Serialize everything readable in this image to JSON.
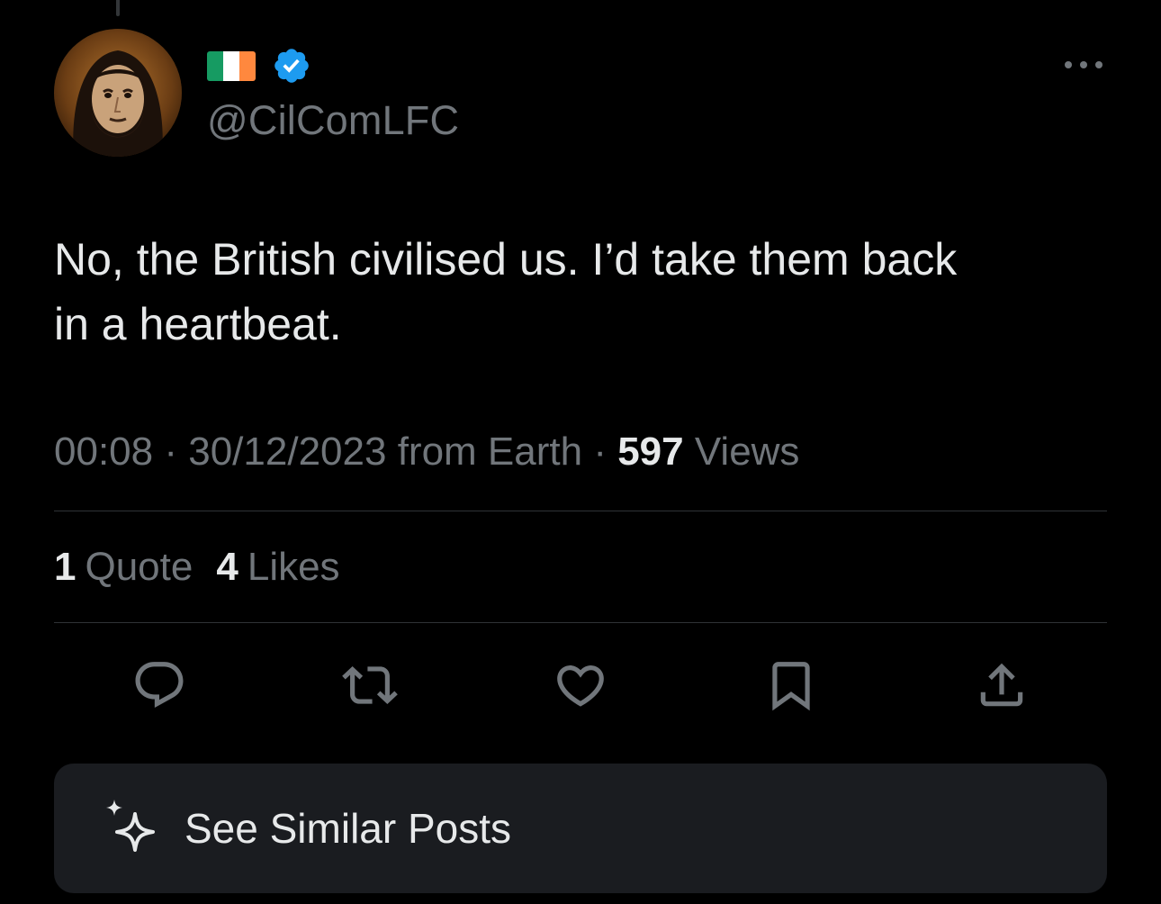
{
  "post": {
    "author": {
      "flag_icon": "ireland-flag-icon",
      "flag_colors": [
        "#169b62",
        "#ffffff",
        "#ff883e"
      ],
      "verified_icon": "verified-badge-icon",
      "verified_color": "#1d9bf0",
      "handle": "@CilComLFC"
    },
    "text_line1": "No, the British civilised us. I’d take them back",
    "text_line2": "in a heartbeat.",
    "time": "00:08",
    "separator": "·",
    "date": "30/12/2023",
    "source": "from Earth",
    "views_count": "597",
    "views_label": "Views"
  },
  "stats": {
    "quotes_count": "1",
    "quotes_label": "Quote",
    "likes_count": "4",
    "likes_label": "Likes"
  },
  "actions": [
    {
      "icon": "reply-icon"
    },
    {
      "icon": "repost-icon"
    },
    {
      "icon": "like-heart-icon"
    },
    {
      "icon": "bookmark-icon"
    },
    {
      "icon": "share-icon"
    }
  ],
  "similar_posts": {
    "icon": "sparkle-icon",
    "label": "See Similar Posts"
  },
  "colors": {
    "background": "#000000",
    "text_primary": "#e7e9ea",
    "text_secondary": "#71767b",
    "divider": "#2f3336",
    "card": "#1a1c20"
  }
}
